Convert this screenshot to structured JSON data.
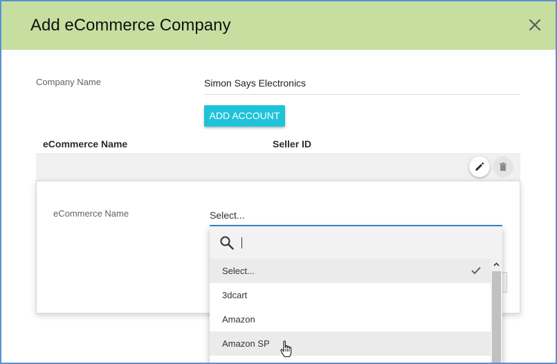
{
  "dialog": {
    "title": "Add eCommerce Company",
    "close_icon": "close-icon"
  },
  "form": {
    "company_name_label": "Company Name",
    "company_name_value": "Simon Says Electronics",
    "add_account_label": "ADD ACCOUNT"
  },
  "table": {
    "columns": [
      "eCommerce Name",
      "Seller ID"
    ],
    "row_actions": [
      "edit-icon",
      "delete-icon"
    ]
  },
  "account_editor": {
    "ecommerce_name_label": "eCommerce Name",
    "select_value": "Select..."
  },
  "dropdown": {
    "search_value": "",
    "options": [
      "Select...",
      "3dcart",
      "Amazon",
      "Amazon SP"
    ],
    "selected_option": "Select...",
    "hovered_option": "Amazon SP"
  },
  "colors": {
    "header_bg": "#c6dfa0",
    "accent_button": "#1ec3d9",
    "focus_underline": "#3a84d6",
    "window_border": "#5b8fd6"
  }
}
